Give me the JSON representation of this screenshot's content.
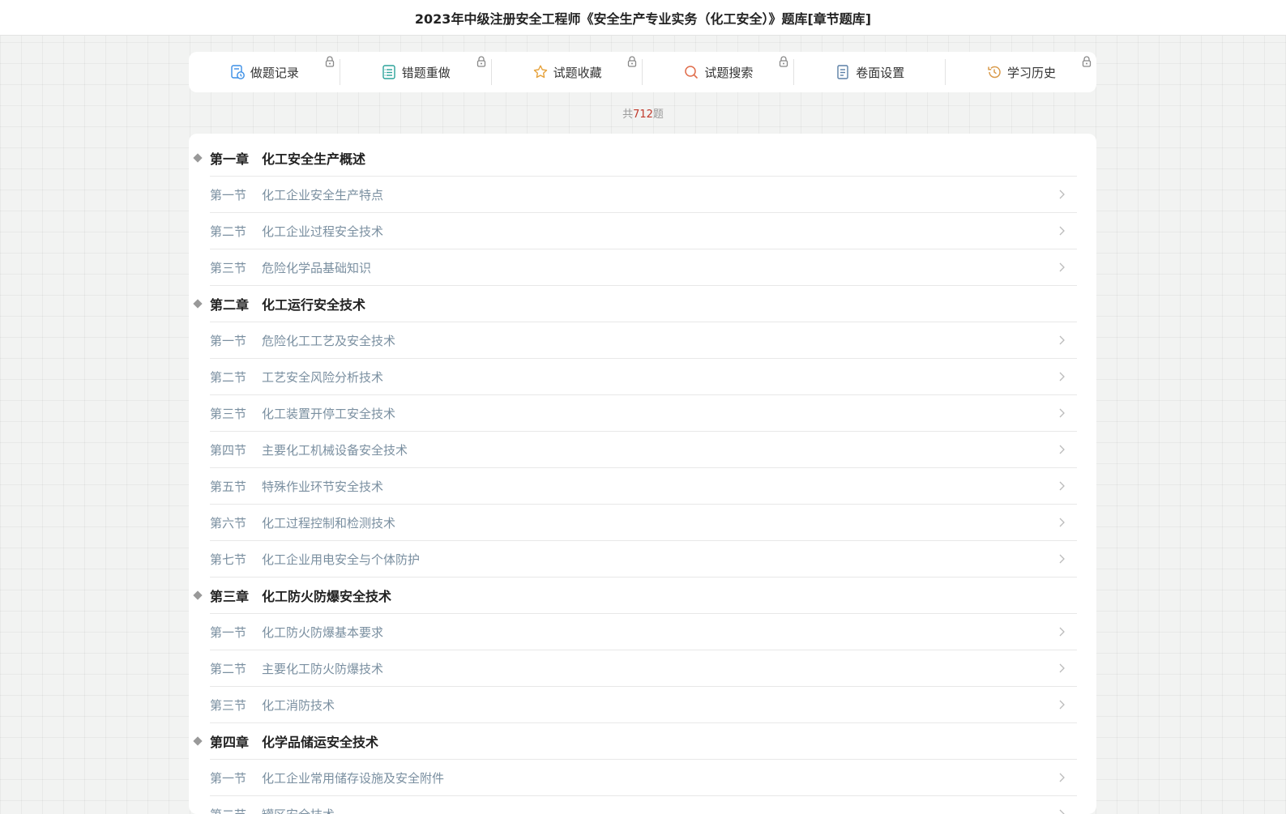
{
  "header": {
    "title": "2023年中级注册安全工程师《安全生产专业实务（化工安全）》题库[章节题库]"
  },
  "toolbar": [
    {
      "label": "做题记录",
      "icon": "record-icon"
    },
    {
      "label": "错题重做",
      "icon": "redo-list-icon"
    },
    {
      "label": "试题收藏",
      "icon": "star-icon"
    },
    {
      "label": "试题搜索",
      "icon": "search-icon"
    },
    {
      "label": "卷面设置",
      "icon": "document-settings-icon"
    },
    {
      "label": "学习历史",
      "icon": "history-icon"
    }
  ],
  "total": {
    "prefix": "共",
    "count": "712",
    "suffix": "题"
  },
  "colors": {
    "accent_red": "#c0392b",
    "section_text": "#7a8fa0",
    "background": "#f2f3f2"
  },
  "chapters": [
    {
      "num": "第一章",
      "title": "化工安全生产概述",
      "sections": [
        {
          "num": "第一节",
          "title": "化工企业安全生产特点"
        },
        {
          "num": "第二节",
          "title": "化工企业过程安全技术"
        },
        {
          "num": "第三节",
          "title": "危险化学品基础知识"
        }
      ]
    },
    {
      "num": "第二章",
      "title": "化工运行安全技术",
      "sections": [
        {
          "num": "第一节",
          "title": "危险化工工艺及安全技术"
        },
        {
          "num": "第二节",
          "title": "工艺安全风险分析技术"
        },
        {
          "num": "第三节",
          "title": "化工装置开停工安全技术"
        },
        {
          "num": "第四节",
          "title": "主要化工机械设备安全技术"
        },
        {
          "num": "第五节",
          "title": "特殊作业环节安全技术"
        },
        {
          "num": "第六节",
          "title": "化工过程控制和检测技术"
        },
        {
          "num": "第七节",
          "title": "化工企业用电安全与个体防护"
        }
      ]
    },
    {
      "num": "第三章",
      "title": "化工防火防爆安全技术",
      "sections": [
        {
          "num": "第一节",
          "title": "化工防火防爆基本要求"
        },
        {
          "num": "第二节",
          "title": "主要化工防火防爆技术"
        },
        {
          "num": "第三节",
          "title": "化工消防技术"
        }
      ]
    },
    {
      "num": "第四章",
      "title": "化学品储运安全技术",
      "sections": [
        {
          "num": "第一节",
          "title": "化工企业常用储存设施及安全附件"
        },
        {
          "num": "第二节",
          "title": "罐区安全技术"
        }
      ]
    }
  ]
}
